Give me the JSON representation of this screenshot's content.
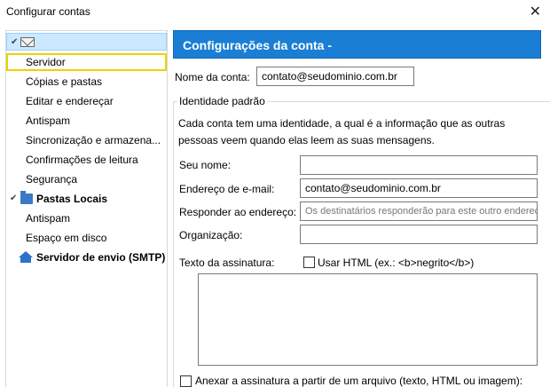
{
  "window": {
    "title": "Configurar contas"
  },
  "sidebar": {
    "items": [
      {
        "label": "Servidor"
      },
      {
        "label": "Cópias e pastas"
      },
      {
        "label": "Editar e endereçar"
      },
      {
        "label": "Antispam"
      },
      {
        "label": "Sincronização e armazena..."
      },
      {
        "label": "Confirmações de leitura"
      },
      {
        "label": "Segurança"
      }
    ],
    "local_folders": {
      "label": "Pastas Locais"
    },
    "local_items": [
      {
        "label": "Antispam"
      },
      {
        "label": "Espaço em disco"
      }
    ],
    "smtp": {
      "label": "Servidor de envio (SMTP)"
    }
  },
  "main": {
    "header": "Configurações da conta -",
    "account_name": {
      "label": "Nome da conta:",
      "value": "contato@seudominio.com.br"
    },
    "identity": {
      "legend": "Identidade padrão",
      "description": "Cada conta tem uma identidade, a qual é a informação que as outras pessoas veem quando elas leem as suas mensagens.",
      "name": {
        "label": "Seu nome:",
        "value": ""
      },
      "email": {
        "label": "Endereço de e-mail:",
        "value": "contato@seudominio.com.br"
      },
      "reply_to": {
        "label": "Responder ao endereço:",
        "placeholder": "Os destinatários responderão para este outro endereço"
      },
      "organization": {
        "label": "Organização:",
        "value": ""
      },
      "signature": {
        "label": "Texto da assinatura:",
        "html_label": "Usar HTML (ex.: <b>negrito</b>)"
      },
      "attach_signature": {
        "label": "Anexar a assinatura a partir de um arquivo (texto, HTML ou imagem):"
      }
    }
  }
}
